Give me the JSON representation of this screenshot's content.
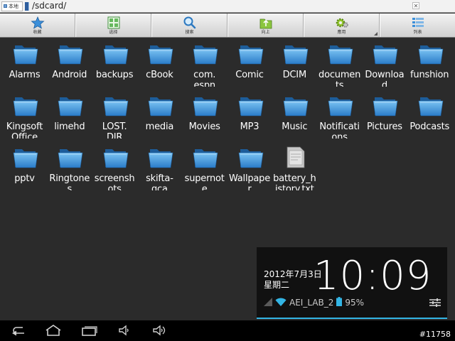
{
  "address_bar": {
    "location_label": "本地",
    "path": "/sdcard/"
  },
  "toolbar": [
    {
      "label": "收藏",
      "icon": "star-icon"
    },
    {
      "label": "选择",
      "icon": "select-grid-icon"
    },
    {
      "label": "搜索",
      "icon": "search-icon"
    },
    {
      "label": "向上",
      "icon": "folder-up-icon"
    },
    {
      "label": "應用",
      "icon": "apps-gear-icon"
    },
    {
      "label": "列表",
      "icon": "list-view-icon"
    }
  ],
  "files": [
    {
      "name": "Alarms",
      "type": "folder"
    },
    {
      "name": "Android",
      "type": "folder"
    },
    {
      "name": "backups",
      "type": "folder"
    },
    {
      "name": "cBook",
      "type": "folder"
    },
    {
      "name": "com.\nespn",
      "type": "folder"
    },
    {
      "name": "Comic",
      "type": "folder"
    },
    {
      "name": "DCIM",
      "type": "folder"
    },
    {
      "name": "documen\nts",
      "type": "folder"
    },
    {
      "name": "Downloa\nd",
      "type": "folder"
    },
    {
      "name": "funshion",
      "type": "folder"
    },
    {
      "name": "Kingsoft\nOffice",
      "type": "folder"
    },
    {
      "name": "limehd",
      "type": "folder"
    },
    {
      "name": "LOST.\nDIR",
      "type": "folder"
    },
    {
      "name": "media",
      "type": "folder"
    },
    {
      "name": "Movies",
      "type": "folder"
    },
    {
      "name": "MP3",
      "type": "folder"
    },
    {
      "name": "Music",
      "type": "folder"
    },
    {
      "name": "Notificati\nons",
      "type": "folder"
    },
    {
      "name": "Pictures",
      "type": "folder"
    },
    {
      "name": "Podcasts",
      "type": "folder"
    },
    {
      "name": "pptv",
      "type": "folder"
    },
    {
      "name": "Ringtone\ns",
      "type": "folder"
    },
    {
      "name": "screensh\nots",
      "type": "folder"
    },
    {
      "name": "skifta-\ngca",
      "type": "folder"
    },
    {
      "name": "supernot\ne",
      "type": "folder"
    },
    {
      "name": "Wallpape\nr",
      "type": "folder"
    },
    {
      "name": "battery_h\nistory.txt",
      "type": "text-file"
    }
  ],
  "notification": {
    "date_line1": "2012年7月3日",
    "date_line2": "星期二",
    "time": "10:09",
    "wifi_name": "AEI_LAB_2",
    "battery": "95%"
  },
  "navbar": {
    "watermark": "#11758",
    "buttons": [
      "back-icon",
      "home-icon",
      "recent-apps-icon",
      "volume-down-icon",
      "volume-up-icon"
    ]
  },
  "colors": {
    "folder_light": "#7cc4f3",
    "folder_dark": "#2a7cc9",
    "accent": "#33b5e5",
    "background": "#2b2b2b"
  }
}
